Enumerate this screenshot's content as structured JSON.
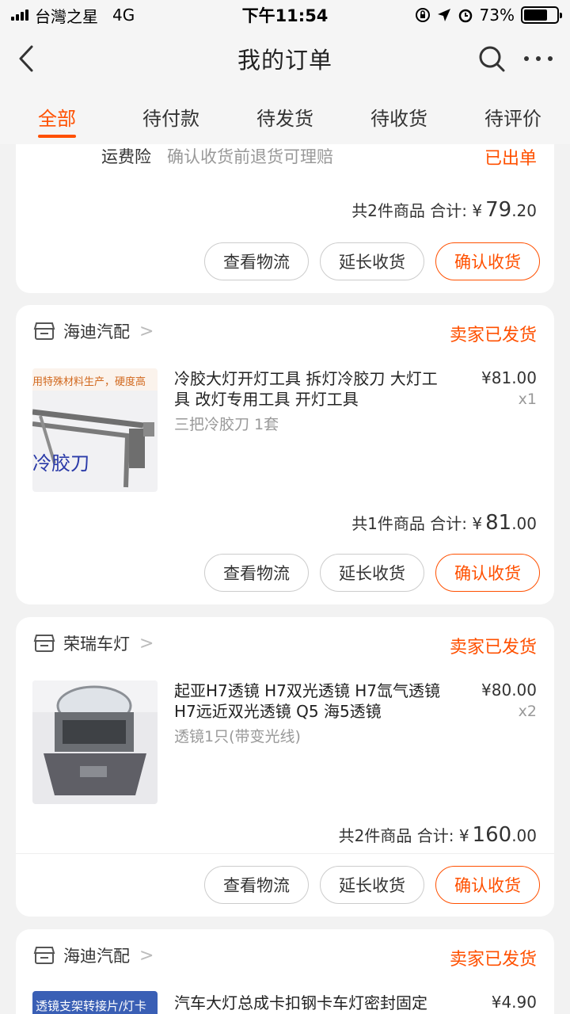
{
  "status_bar": {
    "carrier": "台灣之星",
    "network": "4G",
    "time": "下午11:54",
    "battery": "73%",
    "battery_level": 0.73
  },
  "header": {
    "title": "我的订单"
  },
  "tabs": [
    {
      "label": "全部",
      "active": true
    },
    {
      "label": "待付款",
      "active": false
    },
    {
      "label": "待发货",
      "active": false
    },
    {
      "label": "待收货",
      "active": false
    },
    {
      "label": "待评价",
      "active": false
    }
  ],
  "colors": {
    "accent": "#ff5000"
  },
  "orders": [
    {
      "insurance_label": "运费险",
      "insurance_desc": "确认收货前退货可理赔",
      "insurance_status": "已出单",
      "total_prefix": "共2件商品  合计: ¥",
      "total_int": "79",
      "total_dec": ".20",
      "buttons": [
        "查看物流",
        "延长收货",
        "确认收货"
      ]
    },
    {
      "shop": "海迪汽配",
      "status": "卖家已发货",
      "thumb_text_top": "用特殊材料生产，硬度高",
      "thumb_text_main": "冷胶刀",
      "title": "冷胶大灯开灯工具 拆灯冷胶刀 大灯工具 改灯专用工具 开灯工具",
      "spec": "三把冷胶刀  1套",
      "price": "¥81.00",
      "qty": "x1",
      "total_prefix": "共1件商品  合计: ¥",
      "total_int": "81",
      "total_dec": ".00",
      "buttons": [
        "查看物流",
        "延长收货",
        "确认收货"
      ]
    },
    {
      "shop": "荣瑞车灯",
      "status": "卖家已发货",
      "title": "起亚H7透镜 H7双光透镜 H7氙气透镜 H7远近双光透镜 Q5 海5透镜",
      "spec": "透镜1只(带变光线)",
      "price": "¥80.00",
      "qty": "x2",
      "total_prefix": "共2件商品  合计: ¥",
      "total_int": "160",
      "total_dec": ".00",
      "buttons": [
        "查看物流",
        "延长收货",
        "确认收货"
      ]
    },
    {
      "shop": "海迪汽配",
      "status": "卖家已发货",
      "thumb_banner": "透镜支架转接片/灯卡",
      "title": "汽车大灯总成卡扣钢卡车灯密封固定",
      "price": "¥4.90"
    }
  ]
}
